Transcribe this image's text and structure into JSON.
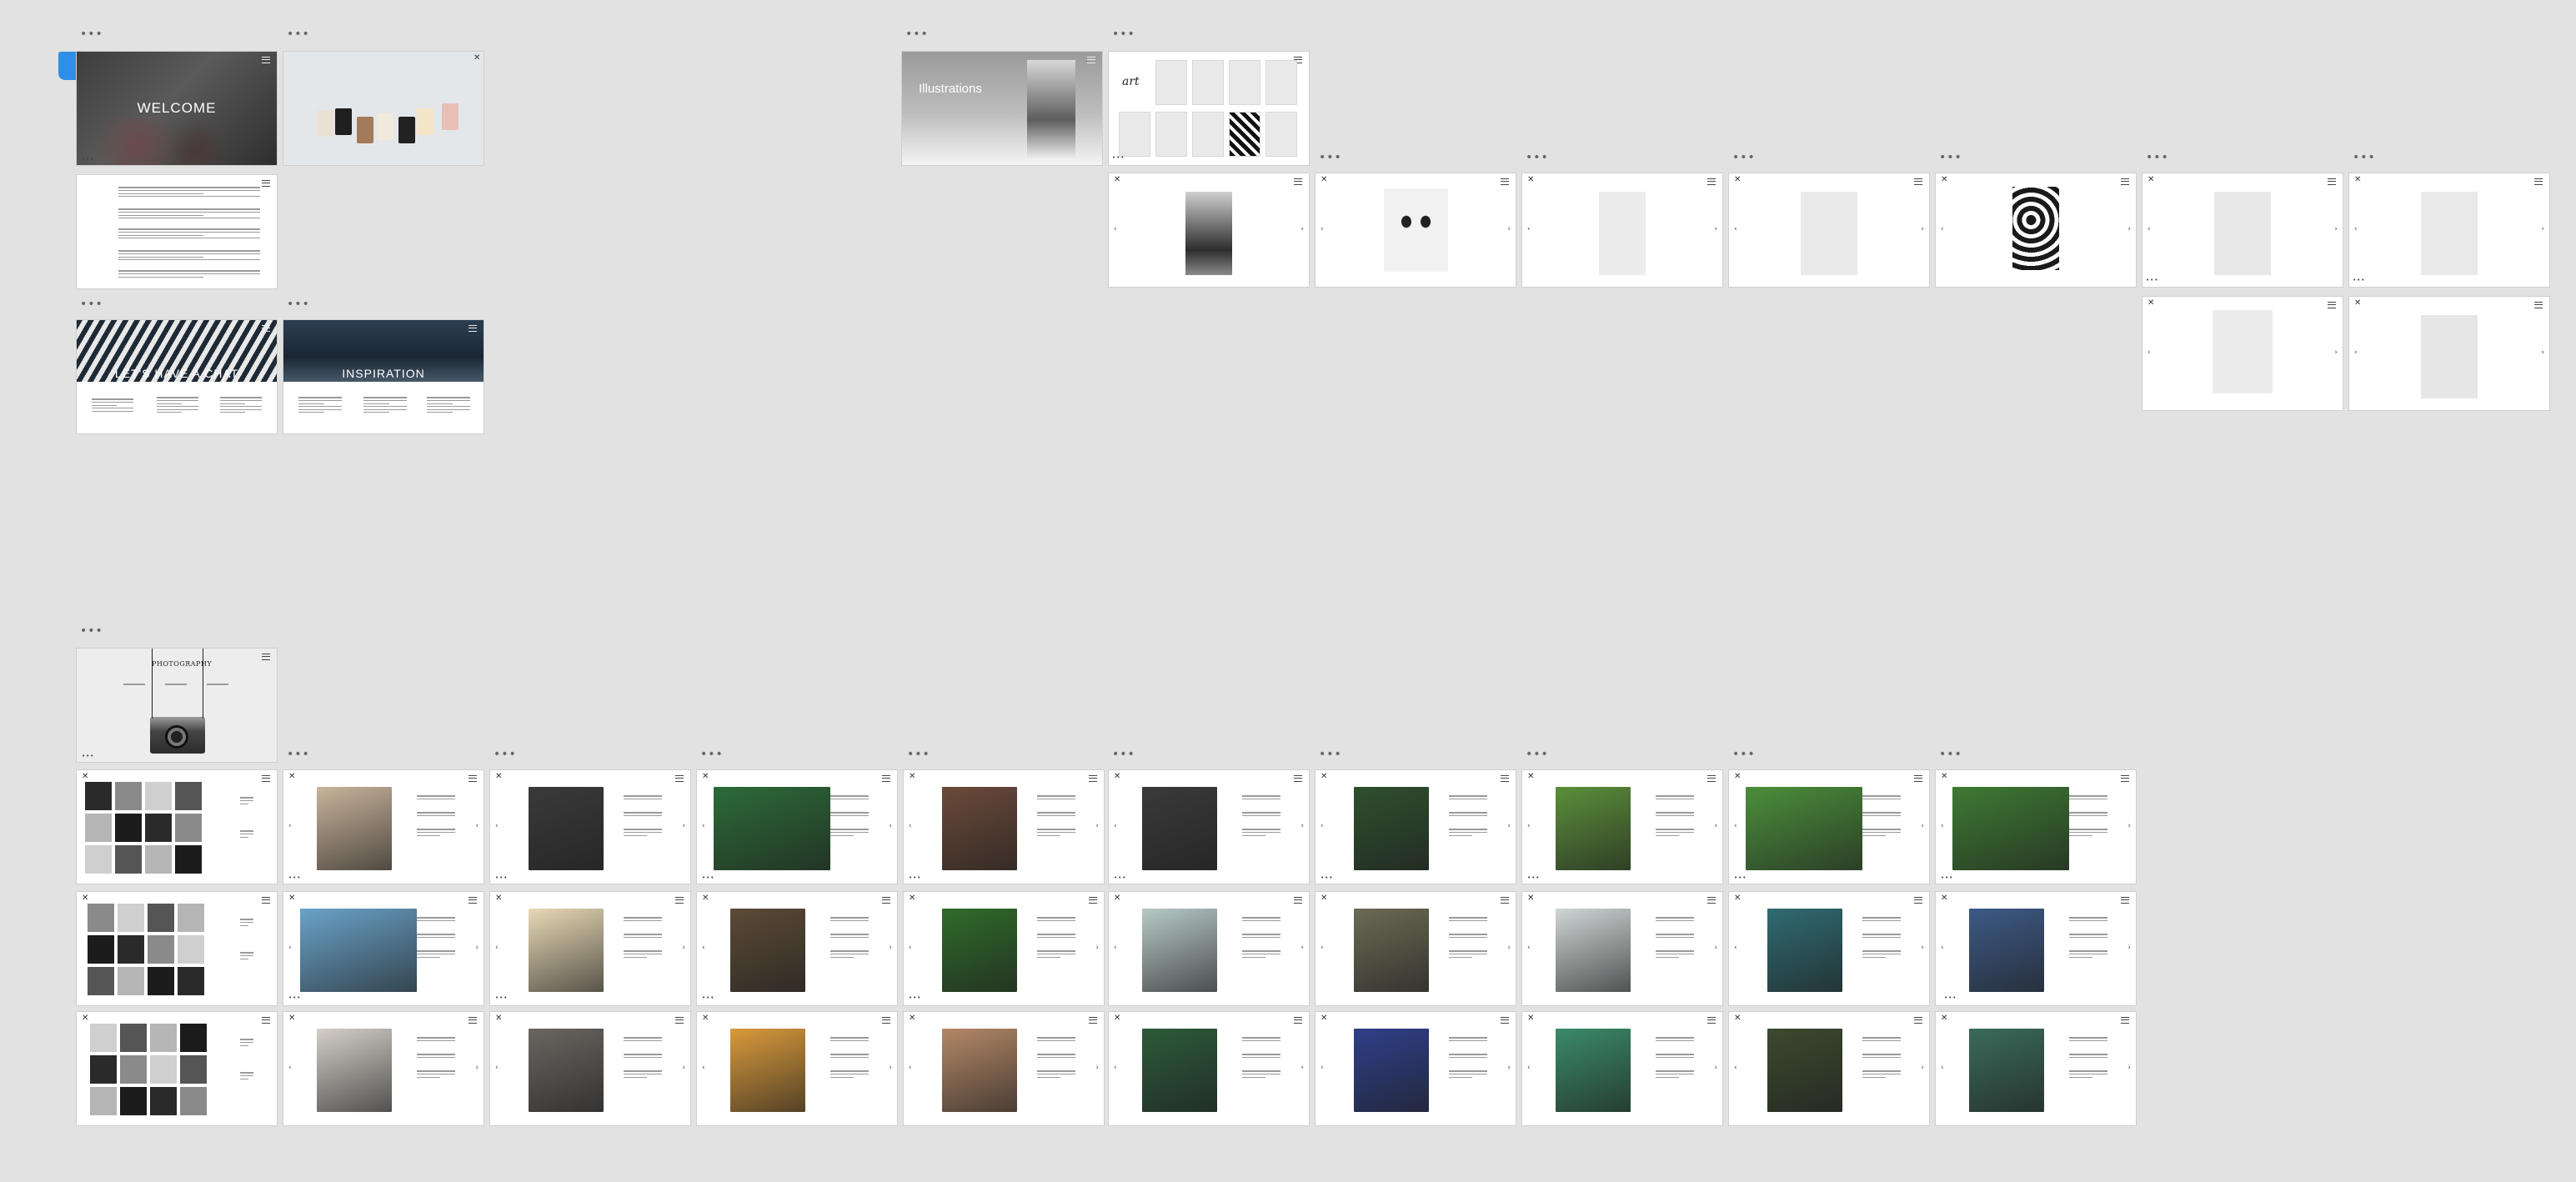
{
  "canvas": {
    "dots_glyph": "•••"
  },
  "icons": {
    "menu": "menu-icon",
    "close": "close-icon",
    "prev": "chevron-left-icon",
    "next": "chevron-right-icon",
    "more": "more-icon",
    "play": "play-icon"
  },
  "glyphs": {
    "close": "✕",
    "prev": "‹",
    "next": "›",
    "page_dots": "•••"
  },
  "colors": {
    "background": "#e2e2e2",
    "accent": "#2f8fe8"
  },
  "welcome": {
    "title": "WELCOME"
  },
  "contact": {
    "title": "LET'S HAVE A CHAT"
  },
  "inspiration": {
    "title": "INSPIRATION"
  },
  "illustrations": {
    "title": "Illustrations"
  },
  "art": {
    "title": "art"
  },
  "photography": {
    "title": "PHOTOGRAPHY"
  }
}
